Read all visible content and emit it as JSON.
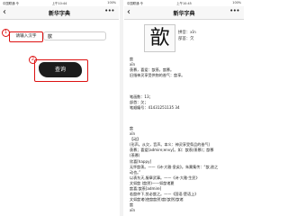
{
  "left": {
    "status": {
      "carrier": "中国联通 令",
      "time": "上午10:44",
      "battery": "100%"
    },
    "nav": {
      "back_label": "‹",
      "title": "新华字典",
      "more_label": "•••"
    },
    "steps": {
      "first": "1",
      "second": "2"
    },
    "input_label": "请输入汉字",
    "search_value": "歆",
    "query_button": "查询"
  },
  "right": {
    "status": {
      "carrier": "中国联通 令",
      "time": "上午10:45",
      "battery": "100%"
    },
    "nav": {
      "back_label": "‹",
      "title": "新华字典",
      "more_label": "•••"
    },
    "character": "歆",
    "pinyin": "拼音：xīn",
    "radical": "部首：欠",
    "basic_lines": [
      "歆",
      "xīn",
      "羡慕，喜爱：歆羡，歆慕。",
      "旧指神灵享受供物的香气：歆享。"
    ],
    "meta_lines": [
      "笔画数：13；",
      "部首：欠；",
      "笔顺编号：41431251135 34"
    ],
    "detail_lines": [
      "歆",
      "xīn",
      "【动】",
      "(形声。从欠，音声。本义：神灵享受祭品的香气)",
      "羡慕；喜爱[admire;envy]。如：歆羡(羡慕)；歆慕",
      "(羡慕)",
      "欣喜[happy]",
      "无怀歆羡。——《诗·大雅·皇矣》。朱熹集传：“歆,欲之",
      "动也。”",
      "以表东天,服章武事。——《诗·大雅·生民》",
      "文如歆 (歆然)——如歆诸夏",
      "歆喜;歆羡[admire]",
      "若歆仲下,势必歆之。——《国语·楚语上》",
      "文如歆诸(使歆歆然)歆(歆然)歆诸",
      "歆",
      "xīn"
    ]
  }
}
